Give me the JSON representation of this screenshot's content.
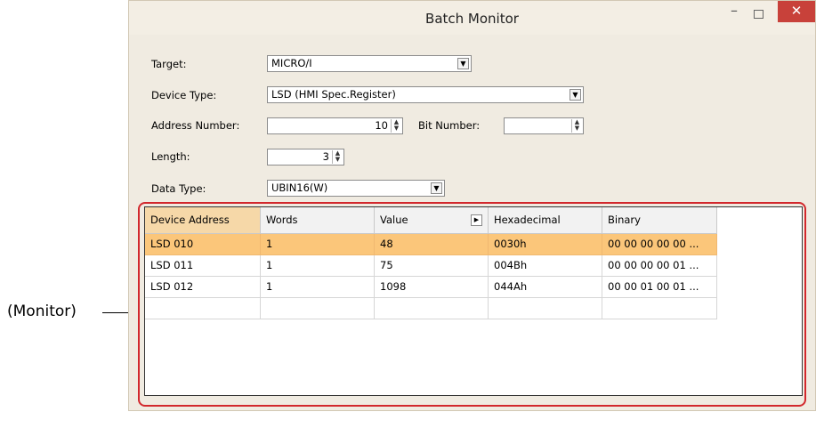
{
  "callout": "(Monitor)",
  "window": {
    "title": "Batch Monitor",
    "minimize": "–",
    "close": "✕"
  },
  "form": {
    "target_label": "Target:",
    "target_value": "MICRO/I",
    "device_type_label": "Device Type:",
    "device_type_value": "LSD (HMI Spec.Register)",
    "address_label": "Address Number:",
    "address_value": "10",
    "bit_label": "Bit Number:",
    "bit_value": "",
    "length_label": "Length:",
    "length_value": "3",
    "data_type_label": "Data Type:",
    "data_type_value": "UBIN16(W)"
  },
  "table": {
    "headers": [
      "Device Address",
      "Words",
      "Value",
      "Hexadecimal",
      "Binary"
    ],
    "rows": [
      [
        "LSD 010",
        "1",
        "48",
        "0030h",
        "00 00 00 00 00 ..."
      ],
      [
        "LSD 011",
        "1",
        "75",
        "004Bh",
        "00 00 00 00 01 ..."
      ],
      [
        "LSD 012",
        "1",
        "1098",
        "044Ah",
        "00 00 01 00 01 ..."
      ],
      [
        "",
        "",
        "",
        "",
        ""
      ]
    ]
  },
  "icons": {
    "dropdown": "chevron-down-icon",
    "spinner": "spinner-icon",
    "sort": "play-icon"
  }
}
